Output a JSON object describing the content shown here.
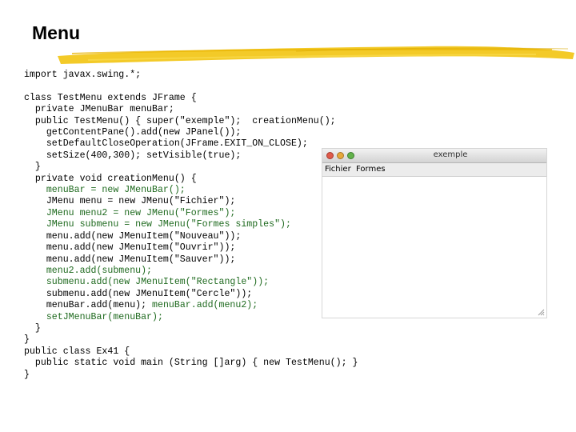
{
  "page": {
    "title": "Menu"
  },
  "code": {
    "lines": [
      "import javax.swing.*;",
      "",
      "class TestMenu extends JFrame {",
      "  private JMenuBar menuBar;",
      "  public TestMenu() { super(\"exemple\");  creationMenu();",
      "    getContentPane().add(new JPanel());",
      "    setDefaultCloseOperation(JFrame.EXIT_ON_CLOSE);",
      "    setSize(400,300); setVisible(true);",
      "  }",
      "  private void creationMenu() {",
      "    menuBar = new JMenuBar();",
      "    JMenu menu = new JMenu(\"Fichier\");",
      "    JMenu menu2 = new JMenu(\"Formes\");",
      "    JMenu submenu = new JMenu(\"Formes simples\");",
      "    menu.add(new JMenuItem(\"Nouveau\"));",
      "    menu.add(new JMenuItem(\"Ouvrir\"));",
      "    menu.add(new JMenuItem(\"Sauver\"));",
      "    menu2.add(submenu);",
      "    submenu.add(new JMenuItem(\"Rectangle\"));",
      "    submenu.add(new JMenuItem(\"Cercle\"));",
      "    menuBar.add(menu); menuBar.add(menu2);",
      "    setJMenuBar(menuBar);",
      "  }",
      "}",
      "public class Ex41 {",
      "  public static void main (String []arg) { new TestMenu(); }",
      "}"
    ],
    "highlighted_lines": [
      10,
      12,
      13,
      17,
      18,
      21
    ],
    "highlighted_fragments": [
      {
        "line": 20,
        "text": "menuBar.add(menu2);"
      }
    ],
    "highlight_color": "#1f6a1f"
  },
  "window": {
    "title": "exemple",
    "menus": [
      "Fichier",
      "Formes"
    ],
    "buttons": [
      "close",
      "minimize",
      "zoom"
    ]
  },
  "colors": {
    "brush": "#f2c411",
    "background": "#ffffff"
  }
}
